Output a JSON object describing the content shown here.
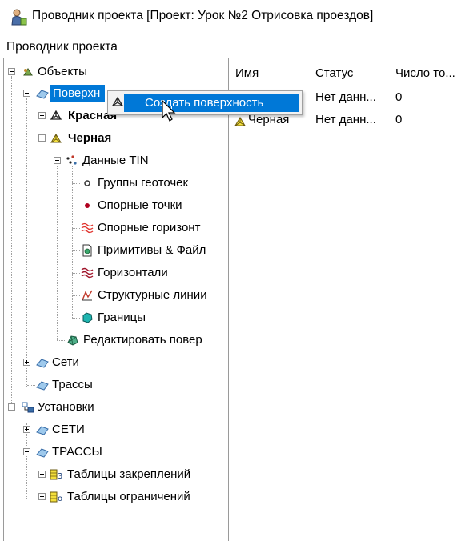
{
  "window": {
    "title": "Проводник проекта [Проект: Урок №2 Отрисовка проездов]",
    "app_icon": "prospector-person-icon"
  },
  "panel": {
    "header": "Проводник проекта"
  },
  "tree": {
    "objects": "Объекты",
    "surfaces": "Поверхн",
    "surface_red": "Красная",
    "surface_black": "Черная",
    "tin_data": "Данные TIN",
    "point_groups": "Группы геоточек",
    "ref_points": "Опорные точки",
    "ref_contours": "Опорные горизонт",
    "primitives": "Примитивы & Файл",
    "contours": "Горизонтали",
    "breaklines": "Структурные линии",
    "boundaries": "Границы",
    "edit_surface": "Редактировать повер",
    "networks": "Сети",
    "alignments": "Трассы",
    "settings": "Установки",
    "settings_networks": "СЕТИ",
    "settings_alignments": "ТРАССЫ",
    "anchor_tables": "Таблицы закреплений",
    "constraint_tables": "Таблицы ограничений"
  },
  "context_menu": {
    "item": "Создать поверхность"
  },
  "list": {
    "columns": [
      "Имя",
      "Статус",
      "Число то..."
    ],
    "rows": [
      {
        "name": "",
        "status": "Нет данн...",
        "count": "0"
      },
      {
        "name": "Черная",
        "status": "Нет данн...",
        "count": "0"
      }
    ]
  },
  "colors": {
    "selection": "#0078d7",
    "border": "#9a9a9a",
    "menu_bg": "#f2f2f2"
  }
}
